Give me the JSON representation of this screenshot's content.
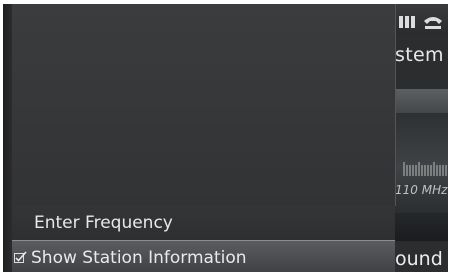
{
  "background_screen": {
    "title_partial": "stem",
    "frequency_partial": "110 MHz",
    "sound_partial": "ound"
  },
  "menu": {
    "items": [
      {
        "label": "Enter Frequency",
        "checked": false
      },
      {
        "label": "Show Station Information",
        "checked": true
      }
    ]
  },
  "icons": {
    "status": [
      "signal-strength-icon",
      "phone-icon"
    ],
    "menu_check": "checkmark-box-icon"
  },
  "colors": {
    "background": "#2c2d2f",
    "text": "#e9e9e9",
    "highlight": "#5a5c5f"
  }
}
